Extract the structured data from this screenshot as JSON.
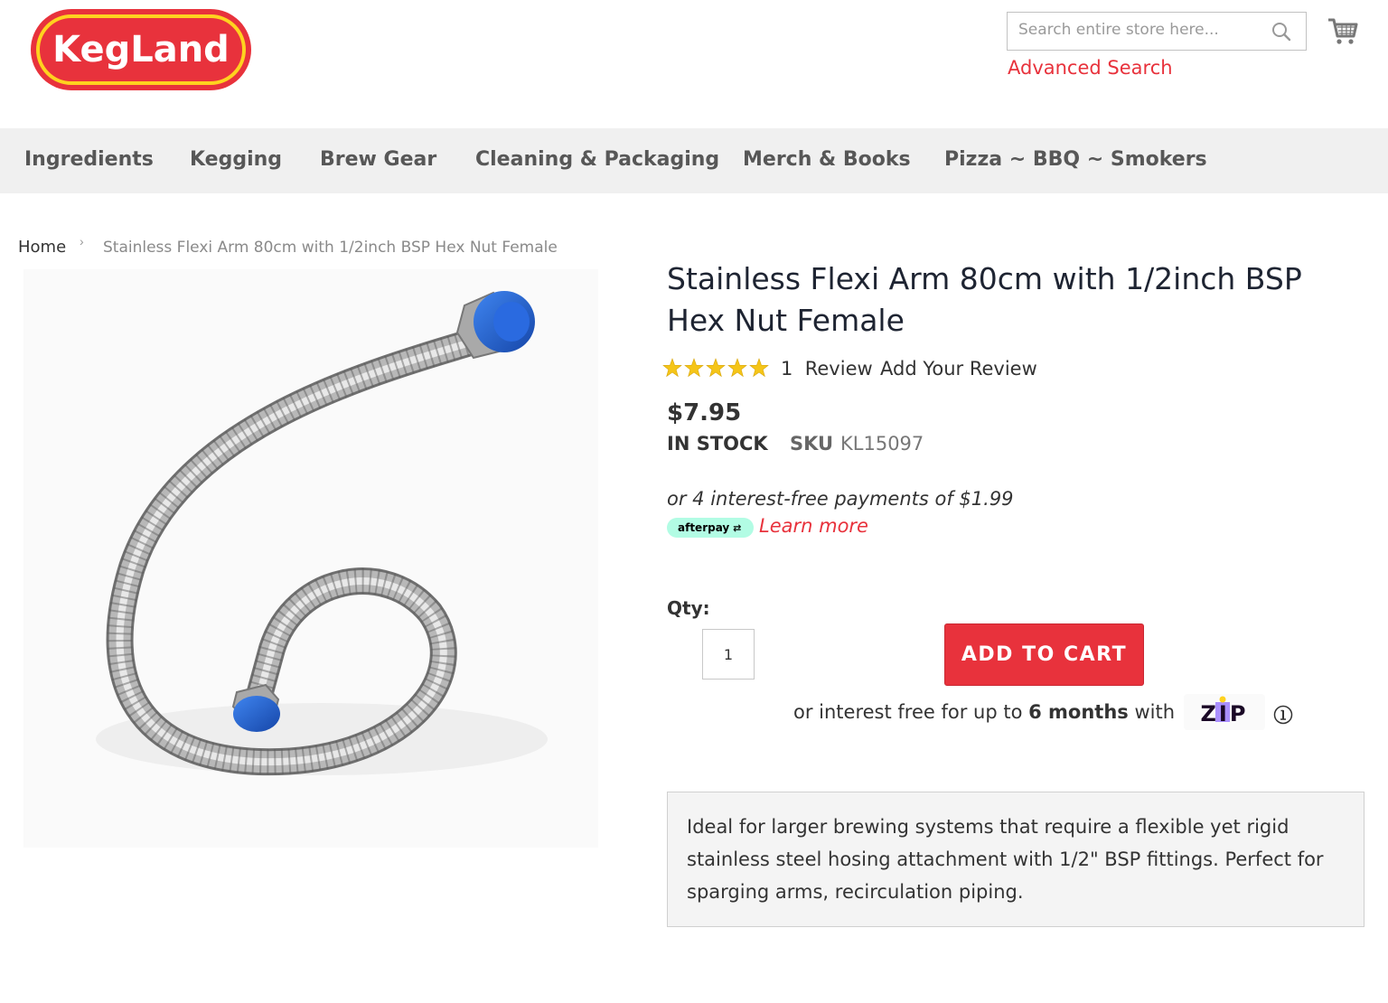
{
  "header": {
    "logo_text": "KegLand",
    "search_placeholder": "Search entire store here...",
    "advanced_search": "Advanced Search"
  },
  "nav": {
    "items": [
      "Ingredients",
      "Kegging",
      "Brew Gear",
      "Cleaning & Packaging",
      "Merch & Books",
      "Pizza ~ BBQ ~ Smokers"
    ]
  },
  "breadcrumb": {
    "home": "Home",
    "separator": "›",
    "current": "Stainless Flexi Arm 80cm with 1/2inch BSP Hex Nut Female"
  },
  "product": {
    "title": "Stainless Flexi Arm 80cm with 1/2inch BSP Hex Nut Female",
    "rating_out_of_5": 5,
    "review_count": "1",
    "review_label": "Review",
    "add_review": "Add Your Review",
    "price": "$7.95",
    "stock": "IN STOCK",
    "sku_label": "SKU",
    "sku": "KL15097",
    "afterpay_text": "or 4 interest-free payments of $1.99",
    "afterpay_badge": "afterpay",
    "learn_more": "Learn more",
    "qty_label": "Qty:",
    "qty_value": "1",
    "add_to_cart": "ADD TO CART",
    "zip_prefix": "or interest free for up to",
    "zip_bold": "6 months",
    "zip_suffix": "with",
    "zip_logo_text": "ZIP",
    "description": "Ideal for larger brewing systems that require a flexible yet rigid stainless steel hosing attachment with 1/2\" BSP fittings. Perfect for sparging arms, recirculation piping."
  },
  "colors": {
    "brand_red": "#e8323c",
    "logo_yellow": "#ffd21f",
    "nav_bg": "#f0f0f0",
    "cap_blue": "#1e5fd0",
    "star_gold": "#f5c518",
    "afterpay_mint": "#b2fce4",
    "zip_purple": "#aa8fff"
  },
  "icons": {
    "search": "search-icon",
    "cart": "cart-icon",
    "info": "info-icon",
    "chevron": "chevron-right-icon"
  }
}
